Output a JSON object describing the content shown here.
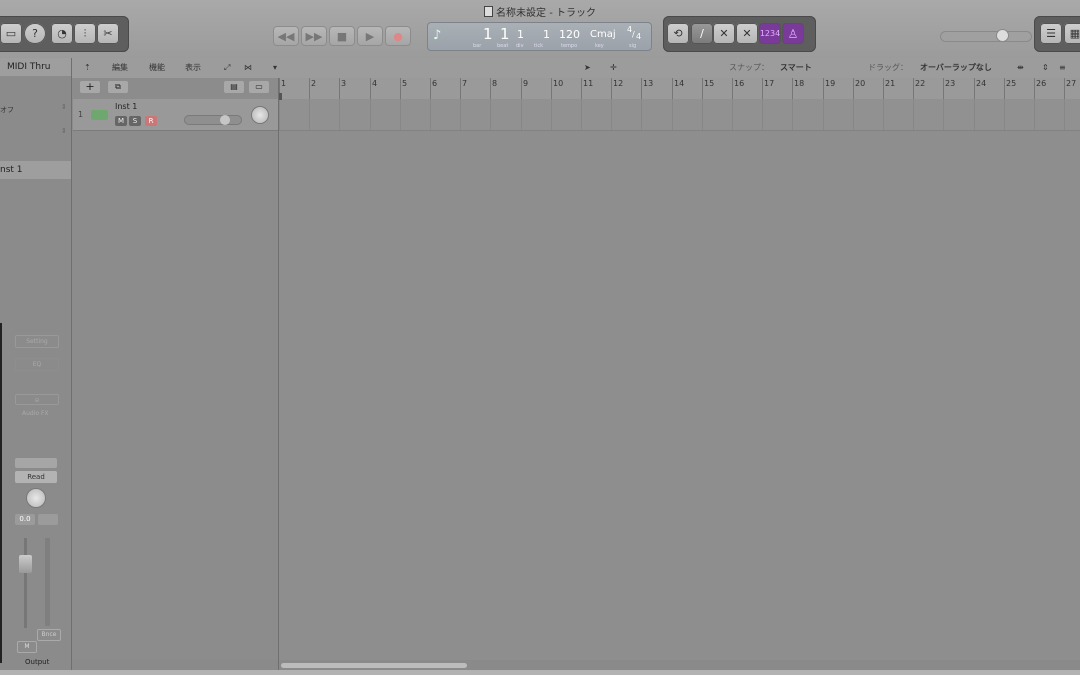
{
  "window": {
    "title": "名称未設定 - トラック"
  },
  "transport": {
    "rewind": "◀◀",
    "forward": "▶▶",
    "stop": "■",
    "play": "▶",
    "record": "●"
  },
  "lcd": {
    "bar": "1",
    "beat": "1",
    "div": "1",
    "tick": "1",
    "tempo": "120",
    "key": "Cmaj",
    "sig_top": "4",
    "sig_bottom": "4",
    "labels": {
      "bar": "bar",
      "beat": "beat",
      "div": "div",
      "tick": "tick",
      "tempo": "tempo",
      "key": "key",
      "sig": "sig"
    }
  },
  "modes": {
    "count_in": "1234"
  },
  "inspector": {
    "region_title": "MIDI Thru",
    "off_label": "オフ",
    "track_title": "nst 1",
    "setting": "Setting",
    "eq": "EQ",
    "audio_fx": "Audio FX",
    "read": "Read",
    "volume_value": "0.0",
    "bnce": "Bnce",
    "mute": "M",
    "output": "Output"
  },
  "trackheader": {
    "edit": "編集",
    "function": "機能",
    "view": "表示",
    "snap_label": "スナップ：",
    "snap_value": "スマート",
    "drag_label": "ドラッグ：",
    "drag_value": "オーバーラップなし"
  },
  "track": {
    "number": "1",
    "name": "Inst 1",
    "mute": "M",
    "solo": "S",
    "rec": "R"
  },
  "ruler": [
    "1",
    "2",
    "3",
    "4",
    "5",
    "6",
    "7",
    "8",
    "9",
    "10",
    "11",
    "12",
    "13",
    "14",
    "15",
    "16",
    "17",
    "18",
    "19",
    "20",
    "21",
    "22",
    "23",
    "24",
    "25",
    "26",
    "27"
  ]
}
